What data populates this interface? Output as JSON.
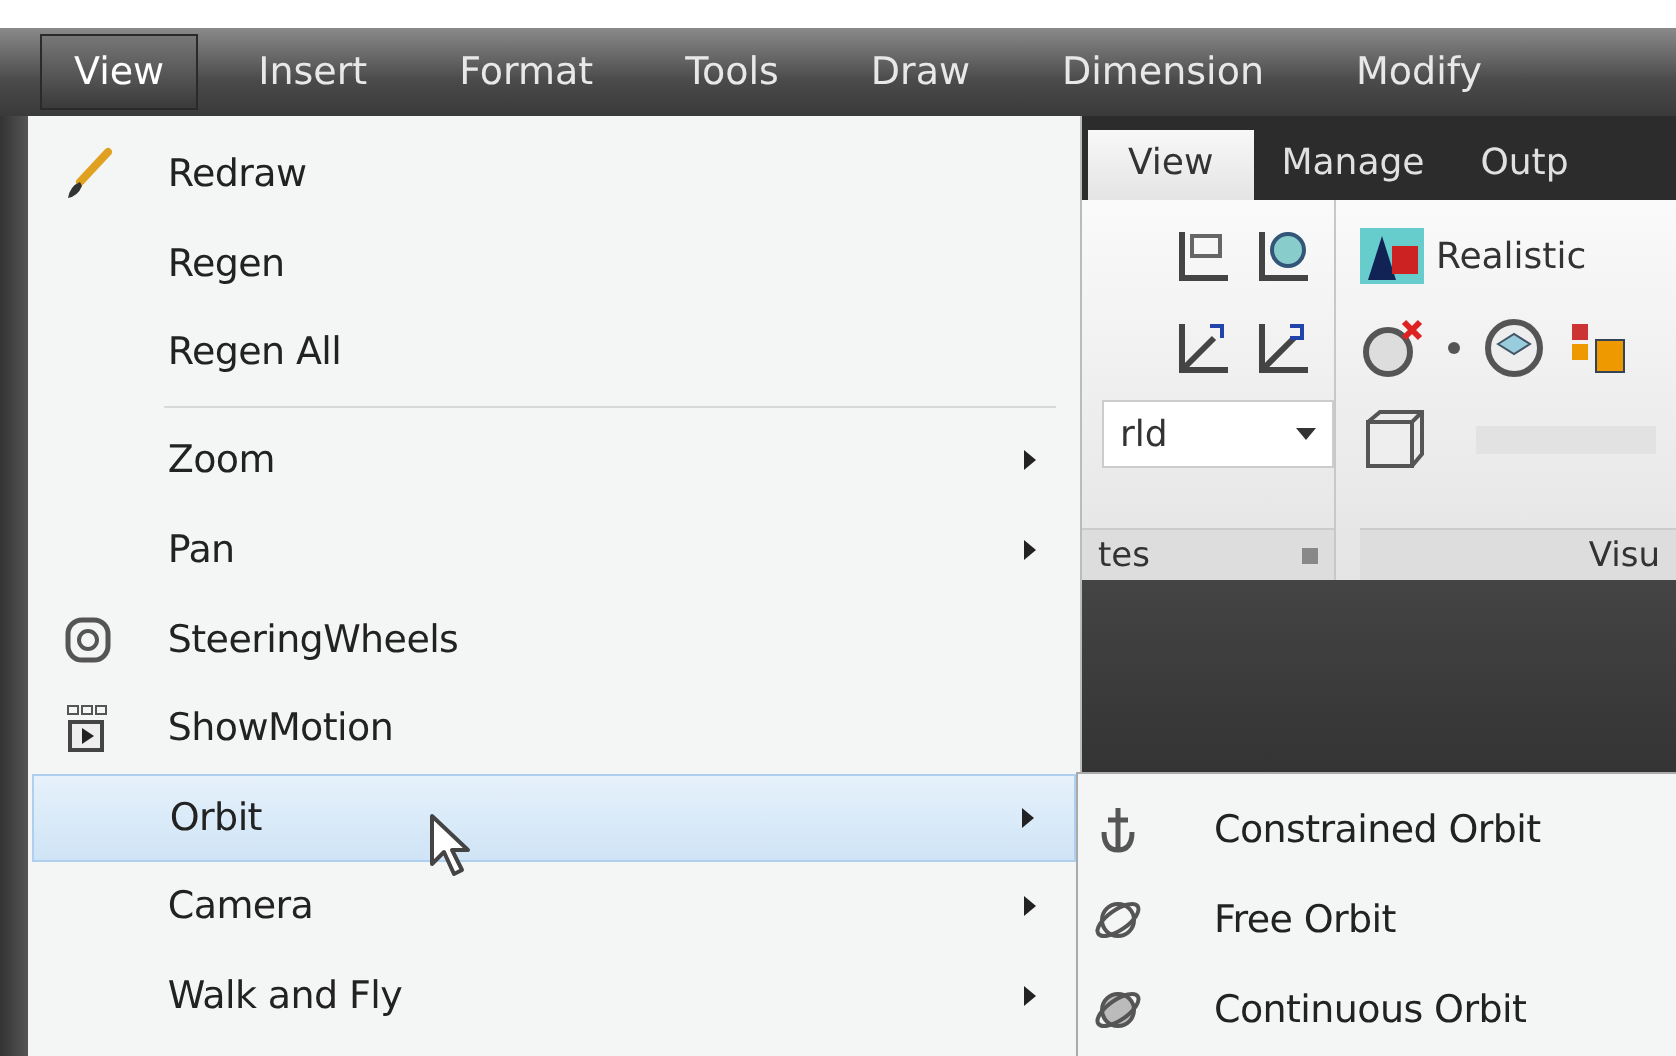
{
  "menubar": [
    {
      "label": "View",
      "selected": true
    },
    {
      "label": "Insert",
      "selected": false
    },
    {
      "label": "Format",
      "selected": false
    },
    {
      "label": "Tools",
      "selected": false
    },
    {
      "label": "Draw",
      "selected": false
    },
    {
      "label": "Dimension",
      "selected": false
    },
    {
      "label": "Modify",
      "selected": false
    }
  ],
  "view_menu": [
    {
      "label": "Redraw",
      "submenu": false,
      "selected": false,
      "separator_before": false
    },
    {
      "label": "Regen",
      "submenu": false,
      "selected": false,
      "separator_before": false
    },
    {
      "label": "Regen All",
      "submenu": false,
      "selected": false,
      "separator_before": false
    },
    {
      "label": "Zoom",
      "submenu": true,
      "selected": false,
      "separator_before": true
    },
    {
      "label": "Pan",
      "submenu": true,
      "selected": false,
      "separator_before": false
    },
    {
      "label": "SteeringWheels",
      "submenu": false,
      "selected": false,
      "separator_before": false
    },
    {
      "label": "ShowMotion",
      "submenu": false,
      "selected": false,
      "separator_before": false
    },
    {
      "label": "Orbit",
      "submenu": true,
      "selected": true,
      "separator_before": false
    },
    {
      "label": "Camera",
      "submenu": true,
      "selected": false,
      "separator_before": false
    },
    {
      "label": "Walk and Fly",
      "submenu": true,
      "selected": false,
      "separator_before": false
    }
  ],
  "ribbon": {
    "tabs": [
      {
        "label": "View",
        "selected": true
      },
      {
        "label": "Manage",
        "selected": false
      },
      {
        "label": "Outp",
        "selected": false
      }
    ],
    "visual_style": "Realistic",
    "coordinates_dropdown": "rld",
    "panel_labels": [
      "tes",
      "Visu"
    ]
  },
  "orbit_submenu": [
    {
      "label": "Constrained Orbit"
    },
    {
      "label": "Free Orbit"
    },
    {
      "label": "Continuous Orbit"
    }
  ]
}
